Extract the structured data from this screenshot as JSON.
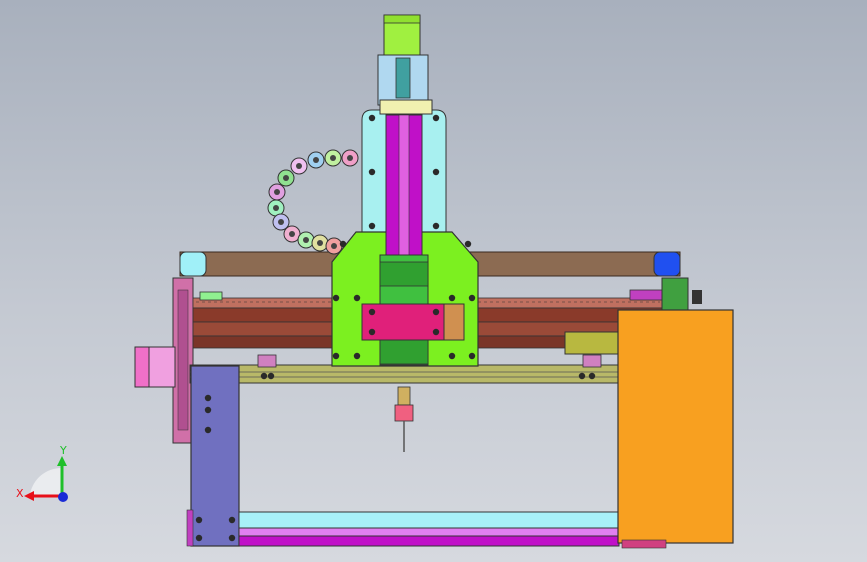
{
  "axes": {
    "x_label": "X",
    "y_label": "Y",
    "x_color": "#e8101a",
    "y_color": "#1fbf2a",
    "z_color": "#1a2bd6"
  },
  "colors": {
    "background": "#b7bdc8",
    "frame_brown": "#8c6b52",
    "rail_red": "#8a3a2a",
    "carriage_green": "#7cf020",
    "z_plate_cyan": "#a8f0f0",
    "spindle_magenta": "#c010c8",
    "clamp_pink": "#e0207a",
    "side_plate_purple": "#7070c0",
    "housing_orange": "#f8a020",
    "motor_lime": "#a0f040",
    "gantry_olive": "#b8b868"
  },
  "icons": {
    "triad": "axis-triad-icon",
    "motor": "stepper-motor-icon",
    "chain": "cable-chain-icon"
  }
}
